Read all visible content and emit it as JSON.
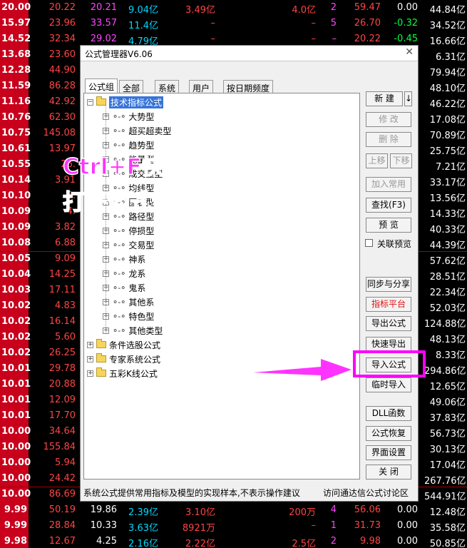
{
  "stock_rows": [
    {
      "pct": "20.00",
      "price": "20.22",
      "c3": "20.21",
      "c4": "9.04亿",
      "c5": "3.49亿",
      "c6": "4.0亿",
      "c7": "2",
      "c8": "59.47",
      "c9": "0.00",
      "c10": "44.84亿"
    },
    {
      "pct": "15.97",
      "price": "23.96",
      "c3": "33.57",
      "c4": "11.4亿",
      "c5": "–",
      "c6": "–",
      "c7": "5",
      "c8": "26.70",
      "c9": "-0.32",
      "c10": "34.52亿"
    },
    {
      "pct": "14.52",
      "price": "32.34",
      "c3": "29.02",
      "c4": "4.79亿",
      "c5": "–",
      "c6": "–",
      "c7": "–",
      "c8": "20.22",
      "c9": "-0.45",
      "c10": "16.66亿"
    },
    {
      "pct": "13.68",
      "price": "23.60",
      "c3": "",
      "c4": "",
      "c5": "",
      "c6": "",
      "c7": "",
      "c8": "",
      "c9": "",
      "c10": "6.31亿"
    },
    {
      "pct": "12.28",
      "price": "44.90",
      "c3": "",
      "c4": "",
      "c5": "",
      "c6": "",
      "c7": "",
      "c8": "",
      "c9": "",
      "c10": "79.94亿"
    },
    {
      "pct": "11.59",
      "price": "86.28",
      "c3": "",
      "c4": "",
      "c5": "",
      "c6": "",
      "c7": "",
      "c8": "",
      "c9": "",
      "c10": "48.10亿"
    },
    {
      "pct": "11.16",
      "price": "42.92",
      "c3": "",
      "c4": "",
      "c5": "",
      "c6": "",
      "c7": "",
      "c8": "",
      "c9": "",
      "c10": "46.22亿"
    },
    {
      "pct": "10.76",
      "price": "62.30",
      "c3": "",
      "c4": "",
      "c5": "",
      "c6": "",
      "c7": "",
      "c8": "",
      "c9": "",
      "c10": "17.08亿"
    },
    {
      "pct": "10.75",
      "price": "145.08",
      "c3": "",
      "c4": "",
      "c5": "",
      "c6": "",
      "c7": "",
      "c8": "",
      "c9": "",
      "c10": "70.89亿"
    },
    {
      "pct": "10.61",
      "price": "13.97",
      "c3": "",
      "c4": "",
      "c5": "",
      "c6": "",
      "c7": "",
      "c8": "",
      "c9": "",
      "c10": "25.75亿"
    },
    {
      "pct": "10.55",
      "price": "26.",
      "c3": "",
      "c4": "",
      "c5": "",
      "c6": "",
      "c7": "",
      "c8": "",
      "c9": "",
      "c10": "7.21亿"
    },
    {
      "pct": "10.14",
      "price": "3.91",
      "c3": "",
      "c4": "",
      "c5": "",
      "c6": "",
      "c7": "",
      "c8": "",
      "c9": "",
      "c10": "33.17亿"
    },
    {
      "pct": "10.10",
      "price": "5.",
      "c3": "",
      "c4": "",
      "c5": "",
      "c6": "",
      "c7": "",
      "c8": "",
      "c9": "",
      "c10": "13.56亿"
    },
    {
      "pct": "10.09",
      "price": "4.",
      "c3": "",
      "c4": "",
      "c5": "",
      "c6": "",
      "c7": "",
      "c8": "",
      "c9": "",
      "c10": "14.33亿"
    },
    {
      "pct": "10.09",
      "price": "3.82",
      "c3": "",
      "c4": "",
      "c5": "",
      "c6": "",
      "c7": "",
      "c8": "",
      "c9": "",
      "c10": "40.33亿"
    },
    {
      "pct": "10.08",
      "price": "6.88",
      "c3": "",
      "c4": "",
      "c5": "",
      "c6": "",
      "c7": "",
      "c8": "",
      "c9": "",
      "c10": "44.39亿"
    },
    {
      "pct": "10.05",
      "price": "9.09",
      "c3": "",
      "c4": "",
      "c5": "",
      "c6": "",
      "c7": "",
      "c8": "",
      "c9": "",
      "c10": "57.62亿"
    },
    {
      "pct": "10.04",
      "price": "14.25",
      "c3": "",
      "c4": "",
      "c5": "",
      "c6": "",
      "c7": "",
      "c8": "",
      "c9": "",
      "c10": "28.51亿"
    },
    {
      "pct": "10.03",
      "price": "17.11",
      "c3": "",
      "c4": "",
      "c5": "",
      "c6": "",
      "c7": "",
      "c8": "",
      "c9": "",
      "c10": "22.34亿"
    },
    {
      "pct": "10.02",
      "price": "4.83",
      "c3": "",
      "c4": "",
      "c5": "",
      "c6": "",
      "c7": "",
      "c8": "",
      "c9": "",
      "c10": "52.03亿"
    },
    {
      "pct": "10.02",
      "price": "16.14",
      "c3": "",
      "c4": "",
      "c5": "",
      "c6": "",
      "c7": "",
      "c8": "",
      "c9": "",
      "c10": "124.88亿"
    },
    {
      "pct": "10.02",
      "price": "5.60",
      "c3": "",
      "c4": "",
      "c5": "",
      "c6": "",
      "c7": "",
      "c8": "",
      "c9": "",
      "c10": "48.13亿"
    },
    {
      "pct": "10.02",
      "price": "26.25",
      "c3": "",
      "c4": "",
      "c5": "",
      "c6": "",
      "c7": "",
      "c8": "",
      "c9": "",
      "c10": "8.33亿"
    },
    {
      "pct": "10.01",
      "price": "29.78",
      "c3": "",
      "c4": "",
      "c5": "",
      "c6": "",
      "c7": "",
      "c8": "",
      "c9": "",
      "c10": "294.86亿"
    },
    {
      "pct": "10.01",
      "price": "20.88",
      "c3": "",
      "c4": "",
      "c5": "",
      "c6": "",
      "c7": "",
      "c8": "",
      "c9": "",
      "c10": "12.65亿"
    },
    {
      "pct": "10.01",
      "price": "12.09",
      "c3": "",
      "c4": "",
      "c5": "",
      "c6": "",
      "c7": "",
      "c8": "",
      "c9": "",
      "c10": "49.06亿"
    },
    {
      "pct": "10.01",
      "price": "17.70",
      "c3": "",
      "c4": "",
      "c5": "",
      "c6": "",
      "c7": "",
      "c8": "",
      "c9": "",
      "c10": "37.83亿"
    },
    {
      "pct": "10.00",
      "price": "34.64",
      "c3": "",
      "c4": "",
      "c5": "",
      "c6": "",
      "c7": "",
      "c8": "",
      "c9": "",
      "c10": "56.73亿"
    },
    {
      "pct": "10.00",
      "price": "155.84",
      "c3": "",
      "c4": "",
      "c5": "",
      "c6": "",
      "c7": "",
      "c8": "",
      "c9": "",
      "c10": "30.13亿"
    },
    {
      "pct": "10.00",
      "price": "5.94",
      "c3": "",
      "c4": "",
      "c5": "",
      "c6": "",
      "c7": "",
      "c8": "",
      "c9": "",
      "c10": "17.04亿"
    },
    {
      "pct": "10.00",
      "price": "24.42",
      "c3": "",
      "c4": "",
      "c5": "",
      "c6": "",
      "c7": "",
      "c8": "",
      "c9": "",
      "c10": "267.76亿"
    },
    {
      "pct": "10.00",
      "price": "86.69",
      "c3": "",
      "c4": "",
      "c5": "",
      "c6": "",
      "c7": "",
      "c8": "",
      "c9": "",
      "c10": "544.91亿"
    },
    {
      "pct": "9.99",
      "price": "50.19",
      "c3": "19.86",
      "c4": "2.39亿",
      "c5": "3.10亿",
      "c6": "200万",
      "c7": "4",
      "c8": "56.06",
      "c9": "0.00",
      "c10": "12.48亿"
    },
    {
      "pct": "9.99",
      "price": "28.84",
      "c3": "10.33",
      "c4": "3.63亿",
      "c5": "8921万",
      "c6": "–",
      "c7": "1",
      "c8": "31.73",
      "c9": "0.00",
      "c10": "35.58亿"
    },
    {
      "pct": "9.98",
      "price": "12.67",
      "c3": "4.25",
      "c4": "2.16亿",
      "c5": "2.22亿",
      "c6": "2.5亿",
      "c7": "2",
      "c8": "9.98",
      "c9": "0.00",
      "c10": "50.85亿"
    }
  ],
  "colors": {
    "accent": "#ff33ff",
    "selection": "#3874d8",
    "danger": "#e01010",
    "pct_bg": "#c8001c"
  },
  "dialog": {
    "title": "公式管理器V6.06",
    "close_icon": "close-icon",
    "tabs": [
      "公式组",
      "全部",
      "系统",
      "用户",
      "按日期频度"
    ],
    "tree": {
      "root": "技术指标公式",
      "children": [
        "大势型",
        "超买超卖型",
        "趋势型",
        "能量型",
        "成交量型",
        "均线型",
        "图表型",
        "路径型",
        "停损型",
        "交易型",
        "神系",
        "龙系",
        "鬼系",
        "其他系",
        "特色型",
        "其他类型"
      ],
      "siblings": [
        "条件选股公式",
        "专家系统公式",
        "五彩K线公式"
      ]
    },
    "buttons": {
      "new": "新 建",
      "new_arrow": "↓",
      "edit": "修 改",
      "delete": "删 除",
      "move_up": "上移",
      "move_down": "下移",
      "add_common": "加入常用",
      "find": "查找(F3)",
      "preview": "预 览",
      "linked_preview": "关联预览",
      "sync_share": "同步与分享",
      "indicator_platform": "指标平台",
      "export_formula": "导出公式",
      "quick_export": "快速导出",
      "import_formula": "导入公式",
      "temp_import": "临时导入",
      "dll_function": "DLL函数",
      "restore_formula": "公式恢复",
      "ui_settings": "界面设置",
      "close": "关 闭"
    },
    "status_left": "系统公式提供常用指标及模型的实现样本,不表示操作建议",
    "status_right": "访问通达信公式讨论区"
  },
  "overlay": {
    "line1": "Ctrl+F快捷键",
    "line2": "打开公式管理器"
  }
}
